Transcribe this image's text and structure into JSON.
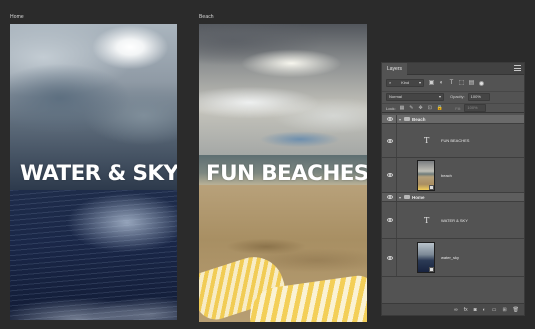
{
  "artboards": {
    "home": {
      "label": "Home",
      "title": "WATER & SKY"
    },
    "beach": {
      "label": "Beach",
      "title": "FUN BEACHES"
    }
  },
  "layers_panel": {
    "tab_label": "Layers",
    "filter": {
      "kind_label": "Kind"
    },
    "blend_mode": "Normal",
    "opacity_label": "Opacity:",
    "opacity_value": "100%",
    "lock_label": "Lock:",
    "fill_label": "Fill:",
    "fill_value": "100%",
    "groups": [
      {
        "name": "Beach",
        "layers": [
          {
            "type": "text",
            "name": "FUN BEACHES"
          },
          {
            "type": "image",
            "name": "beach"
          }
        ]
      },
      {
        "name": "Home",
        "layers": [
          {
            "type": "text",
            "name": "WATER & SKY"
          },
          {
            "type": "image",
            "name": "water_sky"
          }
        ]
      }
    ],
    "footer_icons": [
      "link-icon",
      "fx-icon",
      "mask-icon",
      "adjustment-icon",
      "group-folder-icon",
      "new-layer-icon",
      "trash-icon"
    ],
    "footer_glyphs": {
      "link": "∞",
      "fx": "fx",
      "mask": "◙",
      "adjustment": "◐",
      "folder": "▭",
      "new": "⊞",
      "trash": "🗑"
    }
  }
}
